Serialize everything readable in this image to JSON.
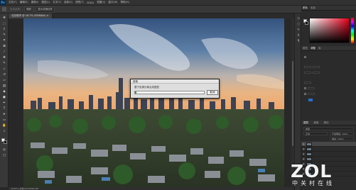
{
  "menubar": {
    "logo": "Ps",
    "items": [
      "文件(F)",
      "编辑(E)",
      "图像(I)",
      "图层(L)",
      "文字(Y)",
      "选择(S)",
      "滤镜(T)",
      "3D(D)",
      "视图(V)",
      "窗口(W)",
      "帮助(H)"
    ]
  },
  "options": {
    "items": [
      "自动选择:",
      "图层",
      "显示变换控件"
    ]
  },
  "document": {
    "tab_label": "北京城市 @ 16.7% (RGB/8#) × "
  },
  "status": {
    "text": "16.67%   文档:64.0M/64.0M"
  },
  "dialog": {
    "title": "进程",
    "message": "基于色调分离合成图层",
    "progress": 0.02,
    "cancel_label": "取消"
  },
  "panel": {
    "color_tabs": [
      "颜色",
      "色板"
    ],
    "prop_tabs": [
      "属性",
      "调整",
      "库"
    ],
    "layer_tabs": [
      "图层",
      "通道",
      "路径"
    ],
    "layer_filter": "类型",
    "layer_blend": "正常",
    "opacity_label": "不透明度: 100%",
    "fill_label": "填充: 100%"
  },
  "watermark": {
    "main": "ZOL",
    "sub": "中关村在线"
  },
  "colors": {
    "accent": "#2ea043",
    "dialog_bg": "#dedede",
    "ps_blue": "#31a8ff"
  }
}
